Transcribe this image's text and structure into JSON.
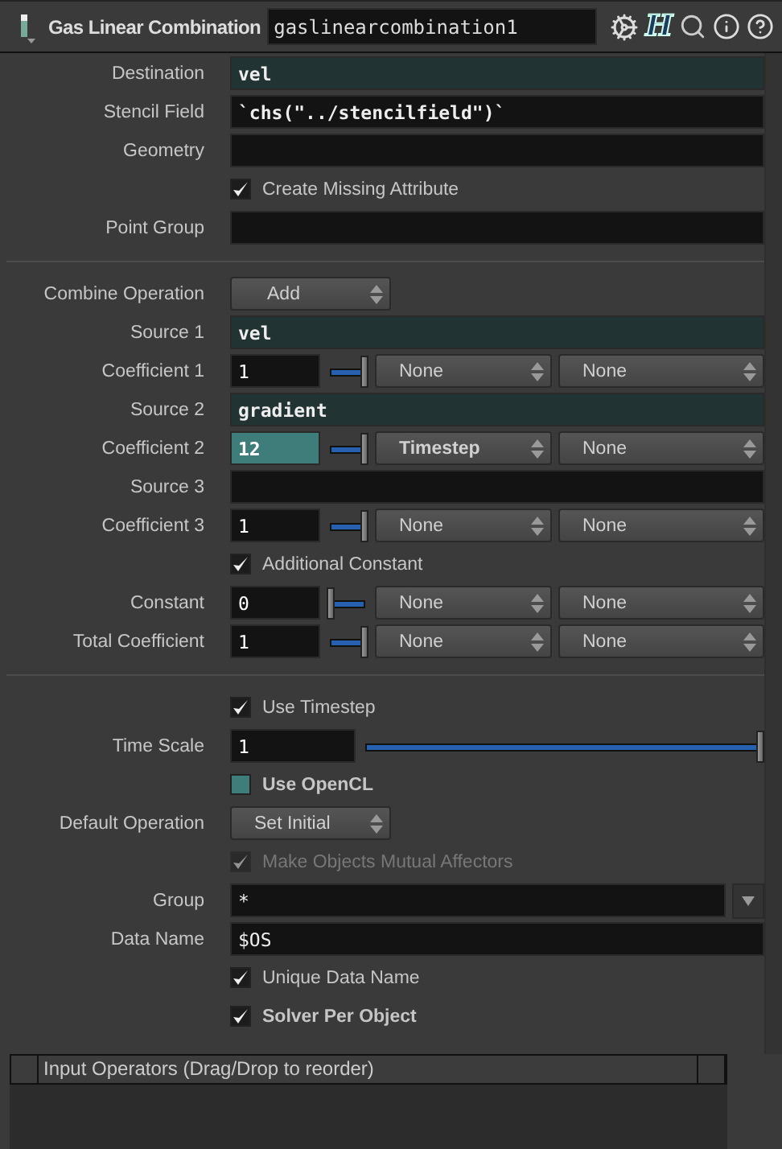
{
  "header": {
    "node_type": "Gas Linear Combination",
    "node_name": "gaslinearcombination1",
    "help_glyph": "H"
  },
  "sections": [
    {
      "rows": [
        {
          "kind": "field",
          "label": "Destination",
          "value": "vel",
          "highlighted": true,
          "bold": true
        },
        {
          "kind": "field",
          "label": "Stencil Field",
          "value": "`chs(\"../stencilfield\")`",
          "highlighted": false,
          "bold": true
        },
        {
          "kind": "field",
          "label": "Geometry",
          "highlighted": false
        },
        {
          "kind": "checkbox",
          "label": "Create Missing Attribute",
          "checked": true,
          "bold": false,
          "disabled": false
        },
        {
          "kind": "field",
          "label": "Point Group",
          "highlighted": false
        }
      ]
    },
    {
      "rows": [
        {
          "kind": "menu",
          "label": "Combine Operation",
          "value": "Add"
        },
        {
          "kind": "field",
          "label": "Source 1",
          "value": "vel",
          "highlighted": true,
          "bold": true
        },
        {
          "kind": "coefficient",
          "label": "Coefficient 1",
          "value": "1",
          "highlighted": false,
          "level": 1,
          "menus": [
            {
              "label": "None",
              "bold": false
            },
            {
              "label": "None",
              "bold": false
            }
          ]
        },
        {
          "kind": "field",
          "label": "Source 2",
          "value": "gradient",
          "highlighted": true,
          "bold": true
        },
        {
          "kind": "coefficient",
          "label": "Coefficient 2",
          "value": "12",
          "highlighted": true,
          "level": 1,
          "menus": [
            {
              "label": "Timestep",
              "bold": true
            },
            {
              "label": "None",
              "bold": false
            }
          ]
        },
        {
          "kind": "field",
          "label": "Source 3",
          "highlighted": false
        },
        {
          "kind": "coefficient",
          "label": "Coefficient 3",
          "value": "1",
          "highlighted": false,
          "level": 1,
          "menus": [
            {
              "label": "None",
              "bold": false
            },
            {
              "label": "None",
              "bold": false
            }
          ]
        },
        {
          "kind": "checkbox",
          "label": "Additional Constant",
          "checked": true,
          "bold": false,
          "disabled": false
        },
        {
          "kind": "coefficient",
          "label": "Constant",
          "value": "0",
          "highlighted": false,
          "level": 0,
          "menus": [
            {
              "label": "None",
              "bold": false
            },
            {
              "label": "None",
              "bold": false
            }
          ]
        },
        {
          "kind": "coefficient",
          "label": "Total Coefficient",
          "value": "1",
          "highlighted": false,
          "level": 1,
          "menus": [
            {
              "label": "None",
              "bold": false
            },
            {
              "label": "None",
              "bold": false
            }
          ]
        }
      ]
    },
    {
      "rows": [
        {
          "kind": "checkbox",
          "label": "Use Timestep",
          "checked": true,
          "bold": false,
          "disabled": false
        },
        {
          "kind": "slider",
          "label": "Time Scale",
          "value": "1",
          "level": 1
        },
        {
          "kind": "checkbox",
          "label": "Use OpenCL",
          "checked": false,
          "bold": true,
          "disabled": false
        },
        {
          "kind": "menu",
          "label": "Default Operation",
          "value": "Set Initial"
        },
        {
          "kind": "checkbox",
          "label": "Make Objects Mutual Affectors",
          "checked": true,
          "bold": false,
          "disabled": true
        },
        {
          "kind": "field_dropdown",
          "label": "Group",
          "value": "*"
        },
        {
          "kind": "field",
          "label": "Data Name",
          "value": "$OS",
          "highlighted": false,
          "bold": false
        },
        {
          "kind": "checkbox",
          "label": "Unique Data Name",
          "checked": true,
          "bold": false,
          "disabled": false
        },
        {
          "kind": "checkbox",
          "label": "Solver Per Object",
          "checked": true,
          "bold": true,
          "disabled": false
        }
      ]
    }
  ],
  "input_table": {
    "header": "Input Operators (Drag/Drop to reorder)"
  }
}
